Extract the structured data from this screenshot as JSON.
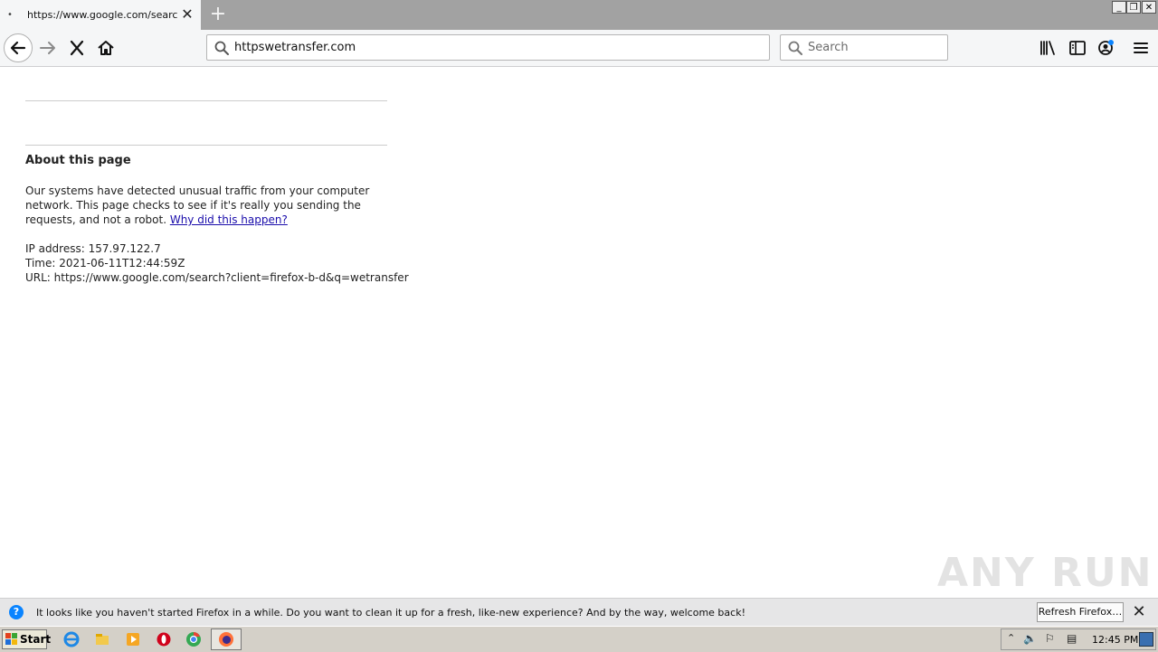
{
  "tab": {
    "title": "https://www.google.com/search?client=firefox-b-d&q=wetransfer",
    "dot": "•"
  },
  "new_tab_label": "+",
  "window_controls": {
    "minimize": "_",
    "restore": "❐",
    "close": "✕"
  },
  "urlbar": {
    "value": "httpswetransfer.com"
  },
  "searchbar": {
    "placeholder": "Search"
  },
  "page": {
    "about_title": "About this page",
    "about_text": "Our systems have detected unusual traffic from your computer network. This page checks to see if it's really you sending the requests, and not a robot. ",
    "why_link": "Why did this happen?",
    "ip_line": "IP address: 157.97.122.7",
    "time_line": "Time: 2021-06-11T12:44:59Z",
    "url_line": "URL: https://www.google.com/search?client=firefox-b-d&q=wetransfer"
  },
  "watermark": "ANY RUN",
  "notification": {
    "text": "It looks like you haven't started Firefox in a while. Do you want to clean it up for a fresh, like-new experience? And by the way, welcome back!",
    "refresh_label": "Refresh Firefox…",
    "close_label": "✕",
    "icon_glyph": "?"
  },
  "taskbar": {
    "start_label": "Start",
    "clock": "12:45 PM",
    "icons": [
      "ie-icon",
      "explorer-icon",
      "media-player-icon",
      "opera-icon",
      "chrome-icon",
      "firefox-icon"
    ]
  },
  "colors": {
    "accent": "#0a84ff",
    "link": "#1a0dab",
    "tabstrip": "#a2a2a2"
  }
}
